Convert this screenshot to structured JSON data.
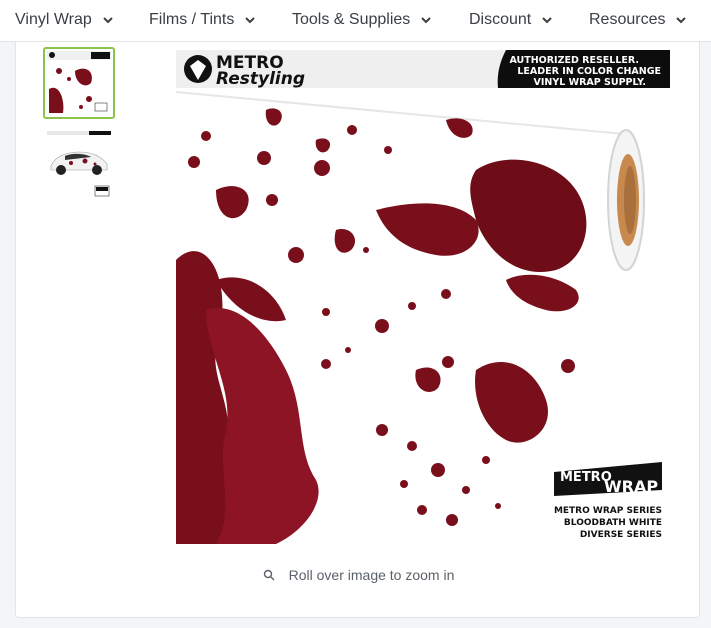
{
  "nav": {
    "items": [
      {
        "label": "Vinyl Wrap"
      },
      {
        "label": "Films / Tints"
      },
      {
        "label": "Tools & Supplies"
      },
      {
        "label": "Discount"
      },
      {
        "label": "Resources"
      }
    ]
  },
  "product_image": {
    "brand_top": "METRO",
    "brand_bottom": "Restyling",
    "banner_lines": [
      "AUTHORIZED RESELLER.",
      "LEADER IN COLOR CHANGE",
      "VINYL WRAP SUPPLY."
    ],
    "wrap_logo_top": "METRO",
    "wrap_logo_bottom": "WRAP",
    "series_lines": [
      "METRO WRAP SERIES",
      "BLOODBATH WHITE",
      "DIVERSE SERIES"
    ],
    "colors": {
      "blood": "#7a0f1c",
      "blood_light": "#a3182a",
      "roll_core": "#c8894e"
    }
  },
  "zoom": {
    "label": "Roll over image to zoom in",
    "icon": "magnifier-icon"
  },
  "colors": {
    "active_thumb_border": "#8bc34a",
    "text": "#3a3f45"
  }
}
